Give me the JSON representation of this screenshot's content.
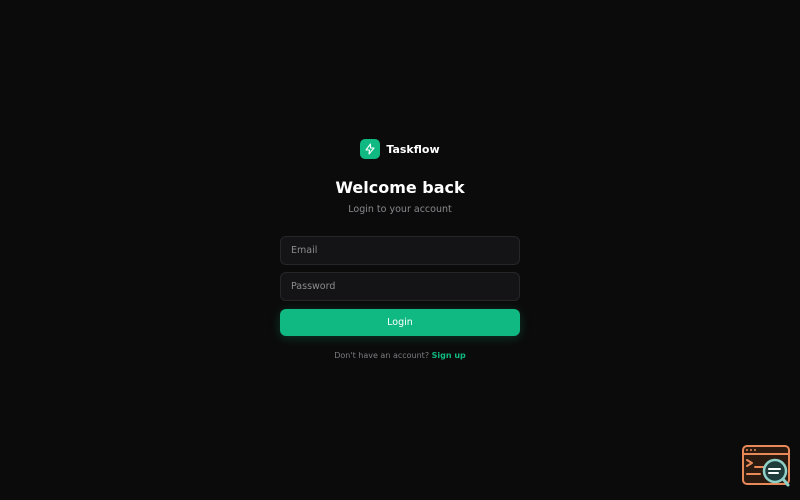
{
  "brand": {
    "name": "Taskflow",
    "logo_icon": "lightning-bolt-icon",
    "accent_color": "#10b981"
  },
  "heading": {
    "title": "Welcome back",
    "subtitle": "Login to your account"
  },
  "form": {
    "email_placeholder": "Email",
    "password_placeholder": "Password",
    "login_label": "Login"
  },
  "footer": {
    "prompt": "Don't have an account?",
    "signup_label": "Sign up"
  },
  "corner_widget": {
    "icon": "terminal-search-icon"
  }
}
